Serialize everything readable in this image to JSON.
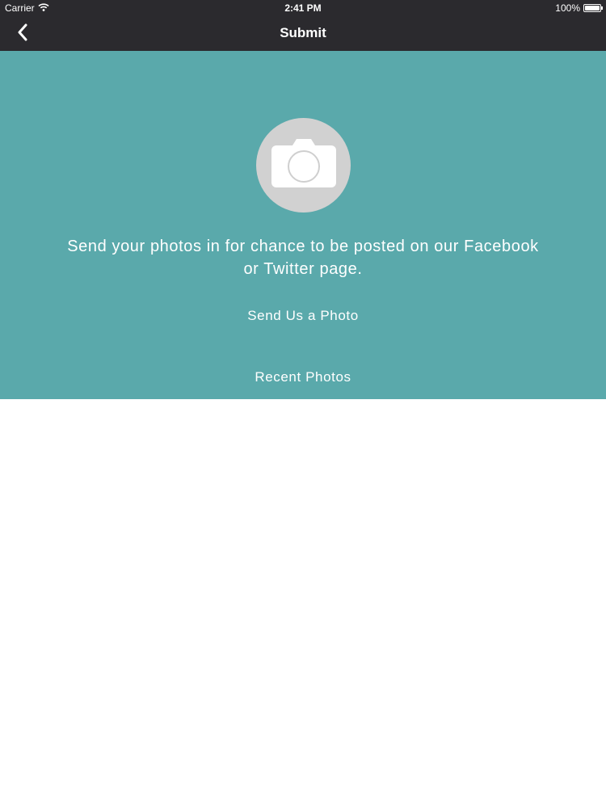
{
  "status_bar": {
    "carrier": "Carrier",
    "time": "2:41 PM",
    "battery": "100%",
    "battery_level": 1.0
  },
  "nav": {
    "title": "Submit",
    "back_icon": "chevron-left-icon"
  },
  "hero": {
    "icon": "camera-icon",
    "message": "Send your photos in for chance to be posted on our Facebook or Twitter page.",
    "send_photo_label": "Send Us a Photo",
    "recent_photos_label": "Recent Photos"
  },
  "colors": {
    "bar_background": "#2b2a2e",
    "hero_background": "#5aa9ab",
    "camera_circle": "#d1d1d1",
    "text": "#ffffff"
  }
}
